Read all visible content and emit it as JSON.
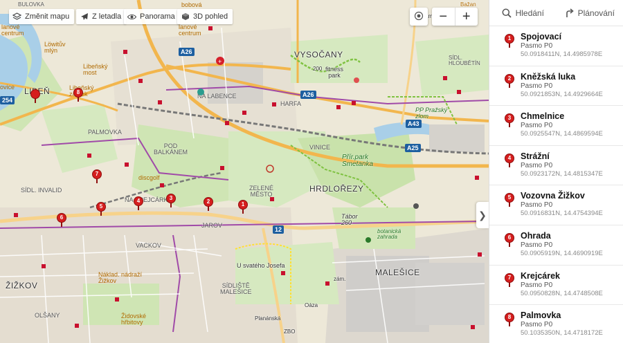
{
  "toolbar": {
    "change_map": "Změnit mapu",
    "aerial": "Z letadla",
    "panorama": "Panorama",
    "view3d": "3D pohled"
  },
  "zoom": {
    "out": "−",
    "in": "+"
  },
  "collapse": "❯",
  "sidebar": {
    "tab_search": "Hledání",
    "tab_planning": "Plánování",
    "items": [
      {
        "num": "1",
        "name": "Spojovací",
        "zone": "Pasmo P0",
        "coords": "50.0918411N, 14.4985978E"
      },
      {
        "num": "2",
        "name": "Kněžská luka",
        "zone": "Pasmo P0",
        "coords": "50.0921853N, 14.4929664E"
      },
      {
        "num": "3",
        "name": "Chmelnice",
        "zone": "Pasmo P0",
        "coords": "50.0925547N, 14.4869594E"
      },
      {
        "num": "4",
        "name": "Strážní",
        "zone": "Pasmo P0",
        "coords": "50.0923172N, 14.4815347E"
      },
      {
        "num": "5",
        "name": "Vozovna Žižkov",
        "zone": "Pasmo P0",
        "coords": "50.0916831N, 14.4754394E"
      },
      {
        "num": "6",
        "name": "Ohrada",
        "zone": "Pasmo P0",
        "coords": "50.0905919N, 14.4690919E"
      },
      {
        "num": "7",
        "name": "Krejcárek",
        "zone": "Pasmo P0",
        "coords": "50.0950828N, 14.4748508E"
      },
      {
        "num": "8",
        "name": "Palmovka",
        "zone": "Pasmo P0",
        "coords": "50.1035350N, 14.4718172E"
      }
    ]
  },
  "map": {
    "pins": [
      "1",
      "2",
      "3",
      "4",
      "5",
      "6",
      "7",
      "8"
    ],
    "labels": {
      "vysocany": "VYSOČANY",
      "liben": "LIBEŇ",
      "hrdlorezy": "HRDLOŘEZY",
      "zizkov": "ŽIŽKOV",
      "malesice": "MALEŠICE",
      "palmovka": "PALMOVKA",
      "pod_balkanem": "POD\nBALKÁNEM",
      "nakrejcarku": "NA KREJCÁRKU",
      "jarov": "JAROV",
      "vackov": "VACKOV",
      "sidl_invalid": "SÍDL. INVALID",
      "zelene_mesto": "ZELENÉ\nMĚSTO",
      "vinice": "VINICE",
      "olsany": "OLŠANY",
      "sidliste_malesice": "SÍDLIŠTĚ\nMALEŠICE",
      "harfa": "HARFA",
      "nadlabence": "NA LABENCE",
      "liben_castle": "Libeňský\nzámek",
      "libensky_most": "Libeňský\nmost",
      "lowit_mlyn": "Löwitův\nmlýn",
      "fitness": "fitness\npark",
      "prirpark": "Přír.park\nSmetanka",
      "pp_zlom": "PP Pražský\nzlom",
      "tabor": "Tábor\n260",
      "botan": "botanická\nzahrada",
      "u_svateho_josefa": "U svatého Josefa",
      "naklad": "Náklad. nádraží\nŽižkov",
      "zidovske": "Židovské\nhřbitovy",
      "discgolf": "discgolf",
      "plananska": "Planánská",
      "oaza": "Oáza",
      "zbo": "ZBO",
      "zam": "zám.",
      "zam2": "zám.",
      "num200": "200",
      "sidl_hloubet": "SÍDL.\nHLOUBĚTÍN",
      "bazana": "Bažan",
      "lanove": "lanové\ncentrum",
      "lanove2": "lanové\ncentrum",
      "bobova": "bobová",
      "bulovka": "BULOVKA",
      "ovice": "ovice"
    },
    "shields": {
      "a26": "A26",
      "a26b": "A26",
      "a43": "A43",
      "a25": "A25",
      "r12": "12",
      "r254": "254"
    }
  }
}
